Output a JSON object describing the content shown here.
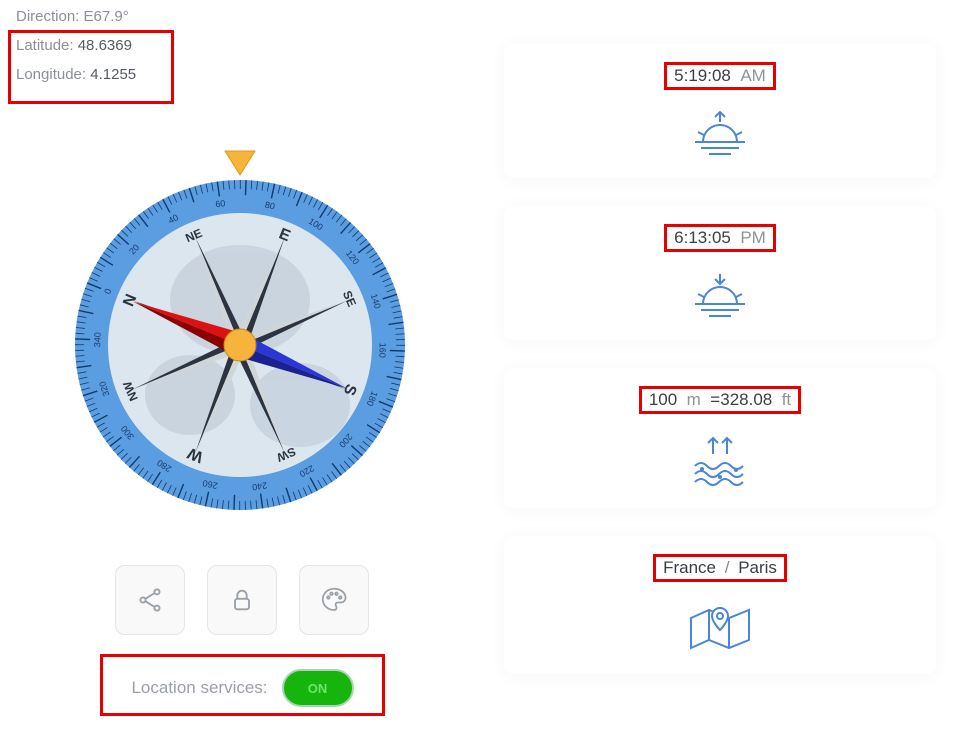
{
  "direction": {
    "label": "Direction:",
    "value": "E67.9°"
  },
  "latitude": {
    "label": "Latitude:",
    "value": "48.6369"
  },
  "longitude": {
    "label": "Longitude:",
    "value": "4.1255"
  },
  "location_services": {
    "label": "Location services:",
    "state_text": "ON"
  },
  "cards": {
    "sunrise": {
      "time": "5:19:08",
      "period": "AM"
    },
    "sunset": {
      "time": "6:13:05",
      "period": "PM"
    },
    "altitude": {
      "value_m": "100",
      "unit_m": "m",
      "eq": "=",
      "value_ft": "328.08",
      "unit_ft": "ft"
    },
    "place": {
      "country": "France",
      "city": "Paris"
    }
  },
  "icons": {
    "share": "share-icon",
    "lock": "lock-icon",
    "palette": "palette-icon"
  }
}
